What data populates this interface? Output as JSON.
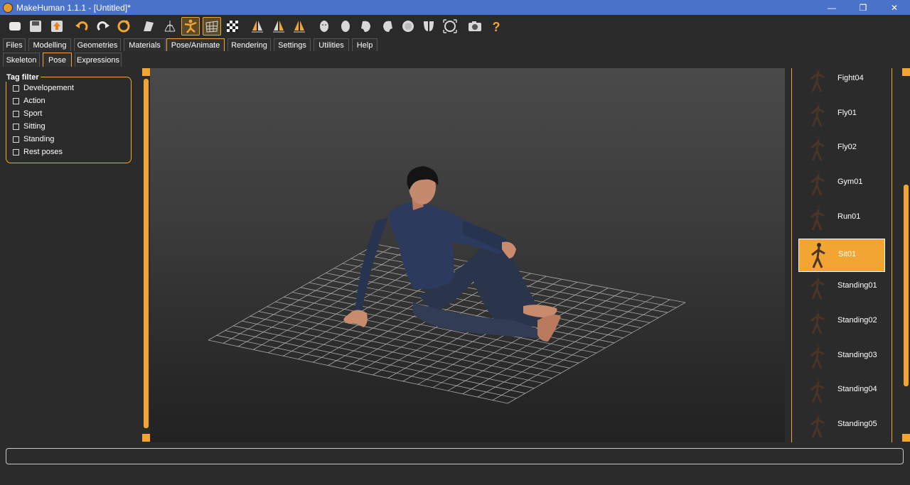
{
  "window": {
    "title": "MakeHuman 1.1.1 - [Untitled]*",
    "minimize": "—",
    "maximize": "❐",
    "close": "✕"
  },
  "toolbar": {
    "icons": [
      "new-file-icon",
      "save-icon",
      "export-icon",
      "undo-icon",
      "redo-icon",
      "reset-icon",
      "smooth-icon",
      "wireframe-icon",
      "pose-icon",
      "grid-icon",
      "background-icon",
      "symmetry-right-icon",
      "symmetry-left-icon",
      "symmetry-icon",
      "front-view-icon",
      "back-view-icon",
      "left-view-icon",
      "right-view-icon",
      "top-view-icon",
      "bottom-view-icon",
      "reset-camera-icon",
      "screenshot-icon",
      "help-icon"
    ]
  },
  "menu_tabs": [
    "Files",
    "Modelling",
    "Geometries",
    "Materials",
    "Pose/Animate",
    "Rendering",
    "Settings",
    "Utilities",
    "Help"
  ],
  "active_menu_tab": "Pose/Animate",
  "sub_tabs": [
    "Skeleton",
    "Pose",
    "Expressions"
  ],
  "active_sub_tab": "Pose",
  "tag_filter": {
    "title": "Tag filter",
    "items": [
      "Developement",
      "Action",
      "Sport",
      "Sitting",
      "Standing",
      "Rest poses"
    ]
  },
  "poses": [
    {
      "name": "Fight04",
      "selected": false
    },
    {
      "name": "Fly01",
      "selected": false
    },
    {
      "name": "Fly02",
      "selected": false
    },
    {
      "name": "Gym01",
      "selected": false
    },
    {
      "name": "Run01",
      "selected": false
    },
    {
      "name": "Sit01",
      "selected": true
    },
    {
      "name": "Standing01",
      "selected": false
    },
    {
      "name": "Standing02",
      "selected": false
    },
    {
      "name": "Standing03",
      "selected": false
    },
    {
      "name": "Standing04",
      "selected": false
    },
    {
      "name": "Standing05",
      "selected": false
    }
  ],
  "colors": {
    "accent": "#f3a533",
    "titlebar": "#4a72c9",
    "background": "#2b2b2b"
  },
  "status": ""
}
